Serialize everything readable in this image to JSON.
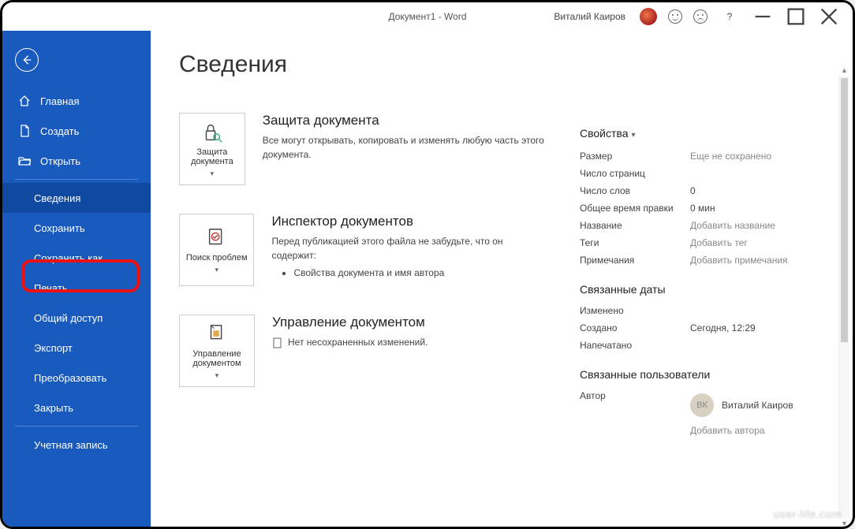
{
  "titlebar": {
    "document_title": "Документ1 - Word",
    "user_name": "Виталий Каиров"
  },
  "sidebar": {
    "home": "Главная",
    "new": "Создать",
    "open": "Открыть",
    "info": "Сведения",
    "save": "Сохранить",
    "save_as": "Сохранить как",
    "print": "Печать",
    "share": "Общий доступ",
    "export": "Экспорт",
    "transform": "Преобразовать",
    "close": "Закрыть",
    "account": "Учетная запись"
  },
  "page": {
    "title": "Сведения"
  },
  "sections": {
    "protect": {
      "tile": "Защита документа",
      "heading": "Защита документа",
      "text": "Все могут открывать, копировать и изменять любую часть этого документа."
    },
    "inspect": {
      "tile": "Поиск проблем",
      "heading": "Инспектор документов",
      "text": "Перед публикацией этого файла не забудьте, что он содержит:",
      "bullet1": "Свойства документа и имя автора"
    },
    "manage": {
      "tile": "Управление документом",
      "heading": "Управление документом",
      "text": "Нет несохраненных изменений."
    }
  },
  "properties": {
    "heading": "Свойства",
    "rows": {
      "size_k": "Размер",
      "size_v": "Еще не сохранено",
      "pages_k": "Число страниц",
      "pages_v": "",
      "words_k": "Число слов",
      "words_v": "0",
      "edit_time_k": "Общее время правки",
      "edit_time_v": "0 мин",
      "title_k": "Название",
      "title_v": "Добавить название",
      "tags_k": "Теги",
      "tags_v": "Добавить тег",
      "comments_k": "Примечания",
      "comments_v": "Добавить примечания"
    },
    "dates_heading": "Связанные даты",
    "dates": {
      "modified_k": "Изменено",
      "modified_v": "",
      "created_k": "Создано",
      "created_v": "Сегодня, 12:29",
      "printed_k": "Напечатано",
      "printed_v": ""
    },
    "people_heading": "Связанные пользователи",
    "author_k": "Автор",
    "author_initials": "ВК",
    "author_name": "Виталий Каиров",
    "add_author": "Добавить автора"
  },
  "watermark": "user-life.com"
}
